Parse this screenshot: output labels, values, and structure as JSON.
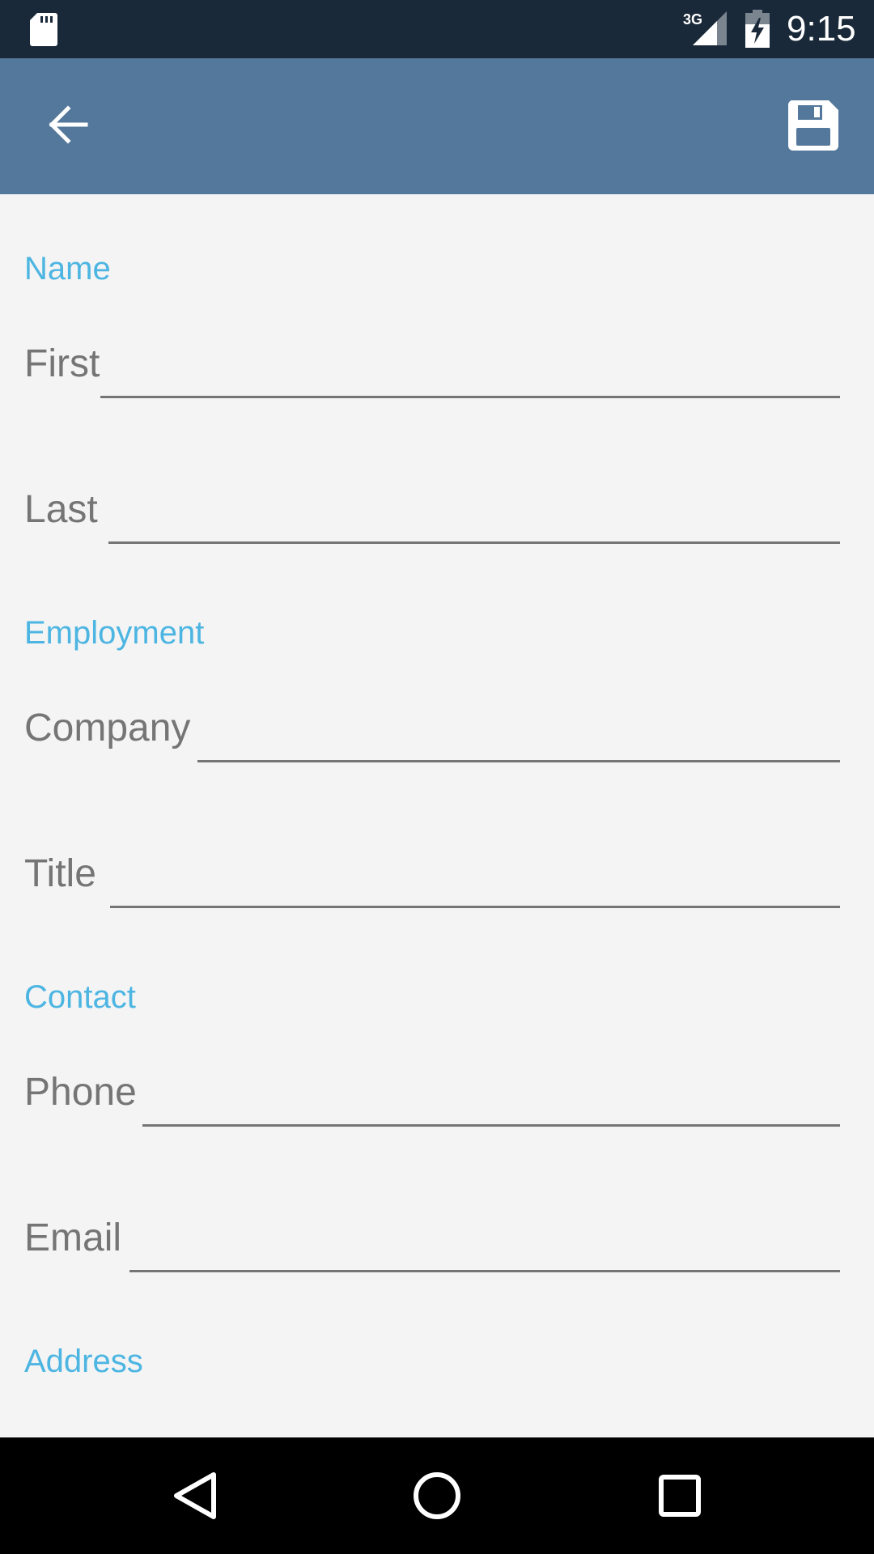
{
  "status_bar": {
    "network": "3G",
    "time": "9:15",
    "icons": [
      "sd-card-icon",
      "signal-3g-icon",
      "battery-charging-icon"
    ]
  },
  "app_bar": {
    "back_icon": "arrow-back-icon",
    "save_icon": "floppy-disk-icon",
    "background_color": "#54789b"
  },
  "form": {
    "sections": [
      {
        "header": "Name",
        "fields": [
          {
            "label": "First",
            "value": ""
          },
          {
            "label": "Last",
            "value": ""
          }
        ]
      },
      {
        "header": "Employment",
        "fields": [
          {
            "label": "Company",
            "value": ""
          },
          {
            "label": "Title",
            "value": ""
          }
        ]
      },
      {
        "header": "Contact",
        "fields": [
          {
            "label": "Phone",
            "value": ""
          },
          {
            "label": "Email",
            "value": ""
          }
        ]
      },
      {
        "header": "Address",
        "fields": []
      }
    ],
    "accent_color": "#4cb5e2",
    "label_color": "#757575"
  },
  "nav_bar": {
    "buttons": [
      "nav-back-icon",
      "nav-home-icon",
      "nav-recents-icon"
    ]
  }
}
